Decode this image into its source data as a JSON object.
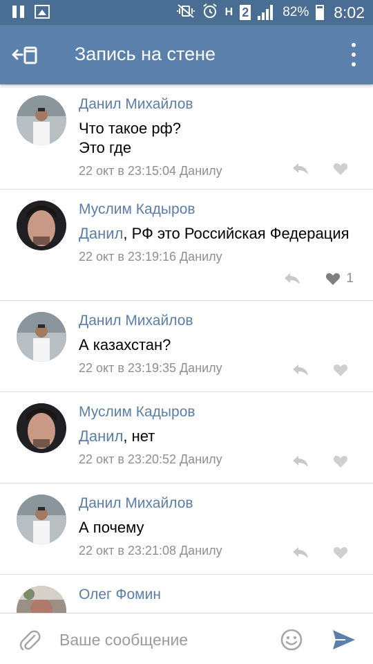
{
  "status_bar": {
    "battery_percent": "82%",
    "time": "8:02",
    "sim_slot": "2",
    "network_label": "H"
  },
  "app_bar": {
    "title": "Запись на стене"
  },
  "comments": [
    {
      "author": "Данил Михайлов",
      "mention": "",
      "text": "Что такое рф?\nЭто где",
      "meta": "22 окт в 23:15:04 Данилу",
      "likes": ""
    },
    {
      "author": "Муслим Кадыров",
      "mention": "Данил",
      "text": ", РФ это Российская Федерация",
      "meta": "22 окт в 23:19:16 Данилу",
      "likes": "1"
    },
    {
      "author": "Данил Михайлов",
      "mention": "",
      "text": "А казахстан?",
      "meta": "22 окт в 23:19:35 Данилу",
      "likes": ""
    },
    {
      "author": "Муслим Кадыров",
      "mention": "Данил",
      "text": ", нет",
      "meta": "22 окт в 23:20:52 Данилу",
      "likes": ""
    },
    {
      "author": "Данил Михайлов",
      "mention": "",
      "text": "А почему",
      "meta": "22 окт в 23:21:08 Данилу",
      "likes": ""
    },
    {
      "author": "Олег Фомин",
      "mention": "",
      "text": "",
      "meta": "",
      "likes": ""
    }
  ],
  "composer": {
    "placeholder": "Ваше сообщение"
  },
  "colors": {
    "status_bar": "#4a6d94",
    "app_bar": "#5b80ab",
    "link": "#5a7ea8",
    "meta": "#8f8f8f",
    "send": "#5b80ab"
  }
}
